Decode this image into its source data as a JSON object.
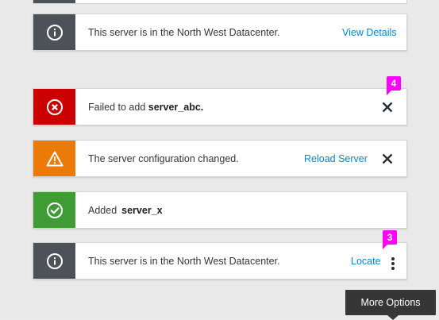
{
  "notifications": [
    {
      "type": "info",
      "icon": "info-circle-icon",
      "message": "This server is in the North West Datacenter.",
      "action_label": "View Details"
    },
    {
      "type": "error",
      "icon": "error-circle-icon",
      "message_prefix": "Failed to add ",
      "message_bold": "server_abc.",
      "badge": "4"
    },
    {
      "type": "warning",
      "icon": "warning-triangle-icon",
      "message": "The server configuration changed.",
      "action_label": "Reload Server"
    },
    {
      "type": "success",
      "icon": "check-circle-icon",
      "message_prefix": "Added",
      "message_bold": "server_x"
    },
    {
      "type": "info",
      "icon": "info-circle-icon",
      "message": "This server is in the North West Datacenter.",
      "action_label": "Locate",
      "badge": "3"
    }
  ],
  "tooltip": {
    "text": "More Options"
  },
  "colors": {
    "info": "#4d5258",
    "error": "#cc0000",
    "warning": "#ec7a08",
    "success": "#3f9c35",
    "link": "#0088ce",
    "badge": "#ff00ff",
    "tooltip_bg": "#363636"
  }
}
